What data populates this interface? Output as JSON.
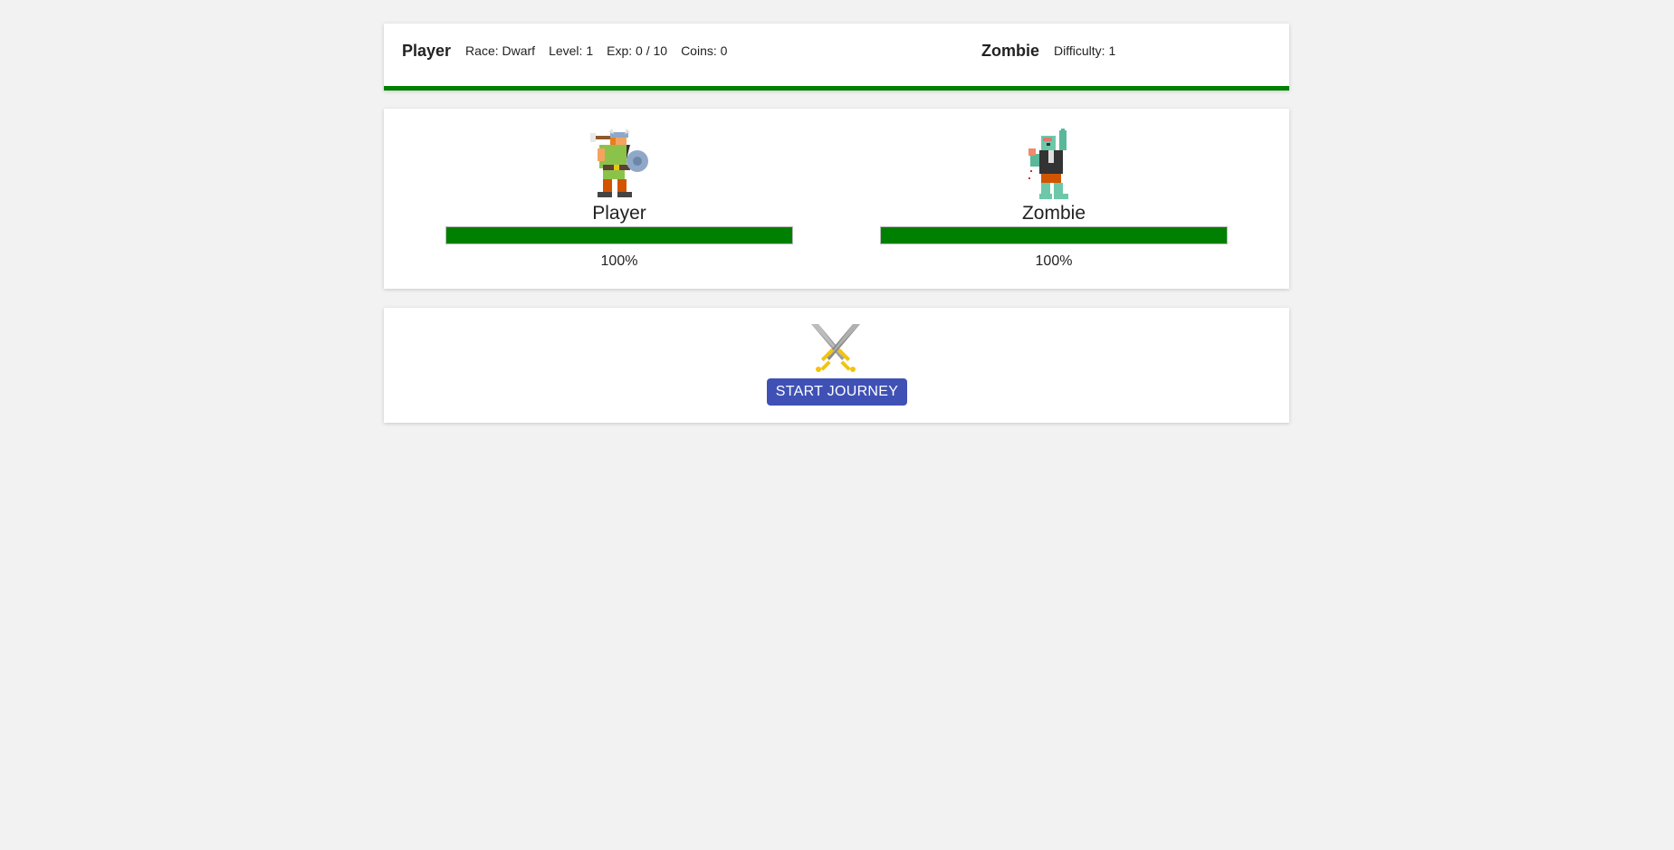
{
  "header": {
    "player": {
      "title": "Player",
      "race": "Race: Dwarf",
      "level": "Level: 1",
      "exp": "Exp: 0 / 10",
      "coins": "Coins: 0"
    },
    "enemy": {
      "title": "Zombie",
      "difficulty": "Difficulty: 1"
    },
    "progress_fraction": 1.0,
    "progress_color": "#008000"
  },
  "arena": {
    "player": {
      "icon": "dwarf-warrior-icon",
      "name": "Player",
      "hp_fraction": 1.0,
      "hp_label": "100%"
    },
    "enemy": {
      "icon": "zombie-icon",
      "name": "Zombie",
      "hp_fraction": 1.0,
      "hp_label": "100%"
    },
    "hp_color": "#008000"
  },
  "action": {
    "icon": "crossed-swords-icon",
    "start_label": "START JOURNEY",
    "button_color": "#3f51b5"
  }
}
